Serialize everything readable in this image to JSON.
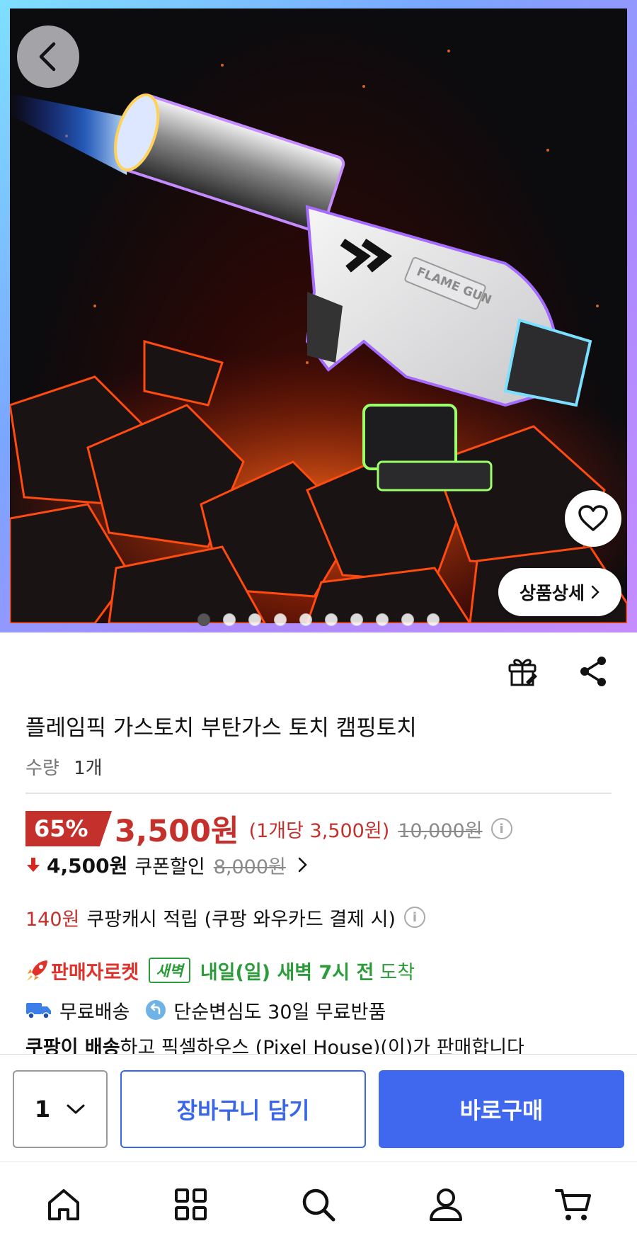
{
  "hero": {
    "product_image": "flame-gun-torch-photo",
    "product_text": "FLAME GUN",
    "detail_button_label": "상품상세",
    "slide_count": 10,
    "active_slide": 0
  },
  "product": {
    "title": "플레임픽 가스토치 부탄가스 토치 캠핑토치",
    "quantity_label": "수량",
    "quantity_value": "1개"
  },
  "price": {
    "discount_rate": "65%",
    "sale_price": "3,500원",
    "unit_price": "(1개당 3,500원)",
    "original_price": "10,000원",
    "coupon_price": "4,500원",
    "coupon_label": "쿠폰할인",
    "coupon_original": "8,000원"
  },
  "cashback": {
    "amount": "140원",
    "text": "쿠팡캐시 적립 (쿠팡 와우카드 결제 시)"
  },
  "delivery": {
    "rocket_label": "판매자로켓",
    "dawn_badge": "새벽",
    "arrival_strong": "내일(일) 새벽 7시 전",
    "arrival_suffix": "도착",
    "free_shipping": "무료배송",
    "free_return": "단순변심도 30일 무료반품",
    "seller_strong": "쿠팡이 배송",
    "seller_text": "하고 픽셀하우스 (Pixel House)(이)가 판매합니다"
  },
  "purchase_bar": {
    "quantity": "1",
    "cart_label": "장바구니 담기",
    "buy_label": "바로구매"
  },
  "colors": {
    "accent_red": "#c4302b",
    "accent_blue": "#3f68ef",
    "dawn_green": "#2c9c3b"
  },
  "nav": {
    "items": [
      "home-icon",
      "category-icon",
      "search-icon",
      "my-coupang-icon",
      "cart-icon"
    ]
  }
}
